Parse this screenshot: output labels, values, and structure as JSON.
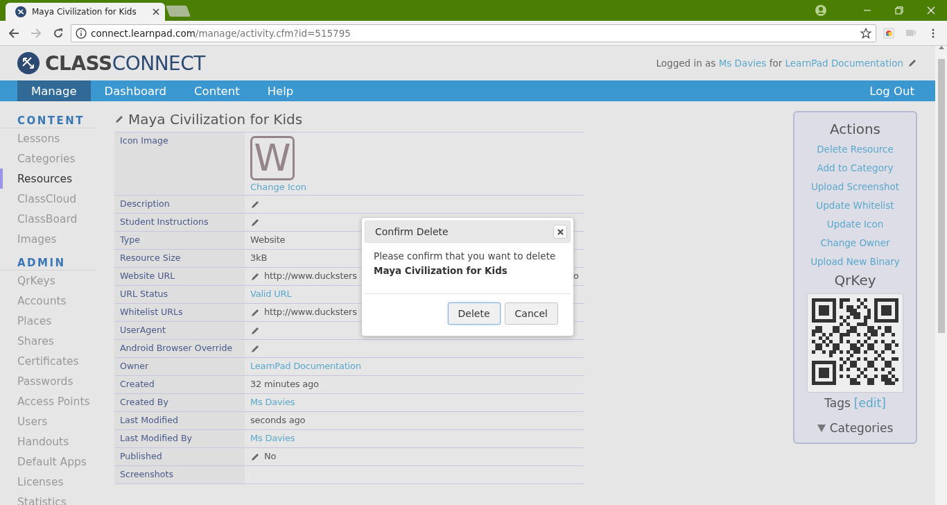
{
  "browser": {
    "tab_title": "Maya Civilization for Kids",
    "url_host": "connect.learnpad.com",
    "url_path": "/manage/activity.cfm?id=515795"
  },
  "header": {
    "logo": "**CLASS**CONNECT",
    "login_prefix": "Logged in as",
    "user": "Ms Davies",
    "login_middle": "for",
    "organisation": "LearnPad Documentation"
  },
  "nav": {
    "items": [
      {
        "label": "Manage",
        "selected": true
      },
      {
        "label": "Dashboard",
        "selected": false
      },
      {
        "label": "Content",
        "selected": false
      },
      {
        "label": "Help",
        "selected": false
      }
    ],
    "logout": "Log Out"
  },
  "sidebar": {
    "sections": [
      {
        "heading": "CONTENT",
        "items": [
          {
            "label": "Lessons",
            "selected": false
          },
          {
            "label": "Categories",
            "selected": false
          },
          {
            "label": "Resources",
            "selected": true
          },
          {
            "label": "ClassCloud",
            "selected": false
          },
          {
            "label": "ClassBoard",
            "selected": false
          },
          {
            "label": "Images",
            "selected": false
          }
        ]
      },
      {
        "heading": "ADMIN",
        "items": [
          {
            "label": "QrKeys",
            "selected": false
          },
          {
            "label": "Accounts",
            "selected": false
          },
          {
            "label": "Places",
            "selected": false
          },
          {
            "label": "Shares",
            "selected": false
          },
          {
            "label": "Certificates",
            "selected": false
          },
          {
            "label": "Passwords",
            "selected": false
          },
          {
            "label": "Access Points",
            "selected": false
          },
          {
            "label": "Users",
            "selected": false
          },
          {
            "label": "Handouts",
            "selected": false
          },
          {
            "label": "Default Apps",
            "selected": false
          },
          {
            "label": "Licenses",
            "selected": false
          },
          {
            "label": "Statistics",
            "selected": false
          }
        ]
      }
    ]
  },
  "resource": {
    "title": "Maya Civilization for Kids",
    "rows": [
      {
        "label": "Icon Image",
        "kind": "icon",
        "icon_letter": "W",
        "link": "Change Icon"
      },
      {
        "label": "Description",
        "kind": "text",
        "editable": true
      },
      {
        "label": "Student Instructions",
        "kind": "text",
        "editable": true
      },
      {
        "label": "Type",
        "kind": "text",
        "value": "Website"
      },
      {
        "label": "Resource Size",
        "kind": "text",
        "value": "3kB"
      },
      {
        "label": "Website URL",
        "kind": "text",
        "editable": true,
        "value": "http://www.ducksters",
        "tail": "o"
      },
      {
        "label": "URL Status",
        "kind": "link",
        "value": "Valid URL"
      },
      {
        "label": "Whitelist URLs",
        "kind": "text",
        "editable": true,
        "value": "http://www.ducksters"
      },
      {
        "label": "UserAgent",
        "kind": "text",
        "editable": true
      },
      {
        "label": "Android Browser Override",
        "kind": "text",
        "editable": true
      },
      {
        "label": "Owner",
        "kind": "link",
        "value": "LearnPad Documentation"
      },
      {
        "label": "Created",
        "kind": "text",
        "value": "32 minutes ago"
      },
      {
        "label": "Created By",
        "kind": "link",
        "value": "Ms Davies"
      },
      {
        "label": "Last Modified",
        "kind": "text",
        "value": "seconds ago"
      },
      {
        "label": "Last Modified By",
        "kind": "link",
        "value": "Ms Davies"
      },
      {
        "label": "Published",
        "kind": "text",
        "editable": true,
        "value": "No"
      },
      {
        "label": "Screenshots",
        "kind": "text"
      }
    ]
  },
  "actions": {
    "title": "Actions",
    "links": [
      "Delete Resource",
      "Add to Category",
      "Upload Screenshot",
      "Update Whitelist",
      "Update Icon",
      "Change Owner",
      "Upload New Binary"
    ],
    "qr_title": "QrKey",
    "tags_label": "Tags",
    "tags_edit": "[edit]",
    "categories": "Categories"
  },
  "dialog": {
    "title": "Confirm Delete",
    "message": "Please confirm that you want to delete",
    "item": "Maya Civilization for Kids",
    "buttons": [
      {
        "label": "Delete",
        "focused": true
      },
      {
        "label": "Cancel",
        "focused": false
      }
    ]
  }
}
